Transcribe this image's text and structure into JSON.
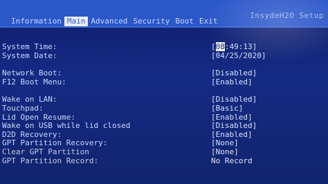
{
  "app": {
    "brand": "InsydeH2O Setup"
  },
  "menu": {
    "items": [
      {
        "label": "Information"
      },
      {
        "label": "Main"
      },
      {
        "label": "Advanced"
      },
      {
        "label": "Security"
      },
      {
        "label": "Boot"
      },
      {
        "label": "Exit"
      }
    ],
    "active_index": 1
  },
  "settings": {
    "system_time": {
      "label": "System Time:",
      "value_prefix": "[",
      "value_cursor": "08",
      "value_rest": ":49:13]"
    },
    "system_date": {
      "label": "System Date:",
      "value": "[04/25/2020]"
    },
    "network_boot": {
      "label": "Network Boot:",
      "value": "[Disabled]"
    },
    "f12_boot_menu": {
      "label": "F12 Boot Menu:",
      "value": "[Enabled]"
    },
    "wake_on_lan": {
      "label": "Wake on LAN:",
      "value": "[Disabled]"
    },
    "touchpad": {
      "label": "Touchpad:",
      "value": "[Basic]"
    },
    "lid_open_resume": {
      "label": "Lid Open Resume:",
      "value": "[Enabled]"
    },
    "wake_on_usb": {
      "label": "Wake on USB while lid closed",
      "value": "[Disabled]"
    },
    "d2d_recovery": {
      "label": "D2D Recovery:",
      "value": "[Enabled]"
    },
    "gpt_partition_recovery": {
      "label": "GPT Partition Recovery:",
      "value": "[None]"
    },
    "clear_gpt_partition": {
      "label": "Clear GPT Partition",
      "value": "[None]"
    },
    "gpt_partition_record": {
      "label": "GPT Partition Record:",
      "value": "No Record"
    }
  },
  "colors": {
    "background": "#152a83",
    "menu_bar": "#2b57c9",
    "active_tab_bg": "#e8ecf7",
    "text": "#c8d7ff"
  }
}
